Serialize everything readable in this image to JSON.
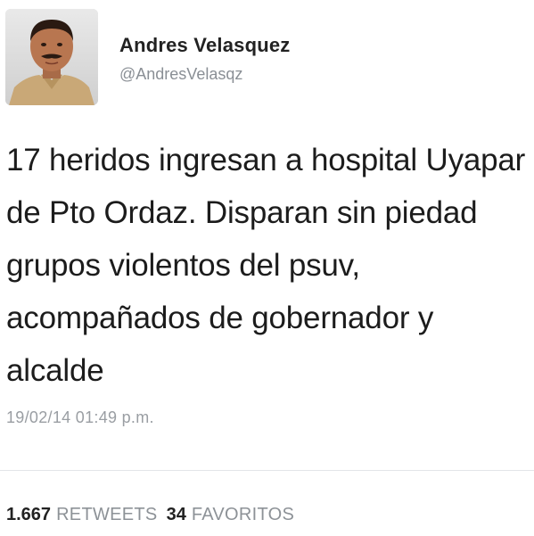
{
  "author": {
    "name": "Andres Velasquez",
    "handle": "@AndresVelasqz",
    "avatar_icon": "profile-photo"
  },
  "tweet": {
    "text": "17 heridos ingresan a hospital Uyapar de Pto Ordaz. Disparan sin piedad grupos violentos del psuv, acompañados de gobernador y alcalde",
    "timestamp": "19/02/14 01:49 p.m."
  },
  "stats": {
    "retweets_count": "1.667",
    "retweets_label": "RETWEETS",
    "favorites_count": "34",
    "favorites_label": "FAVORITOS"
  },
  "colors": {
    "background": "#ffffff",
    "text": "#1c1c1c",
    "muted": "#8d9297",
    "divider": "#e3e5e8"
  }
}
